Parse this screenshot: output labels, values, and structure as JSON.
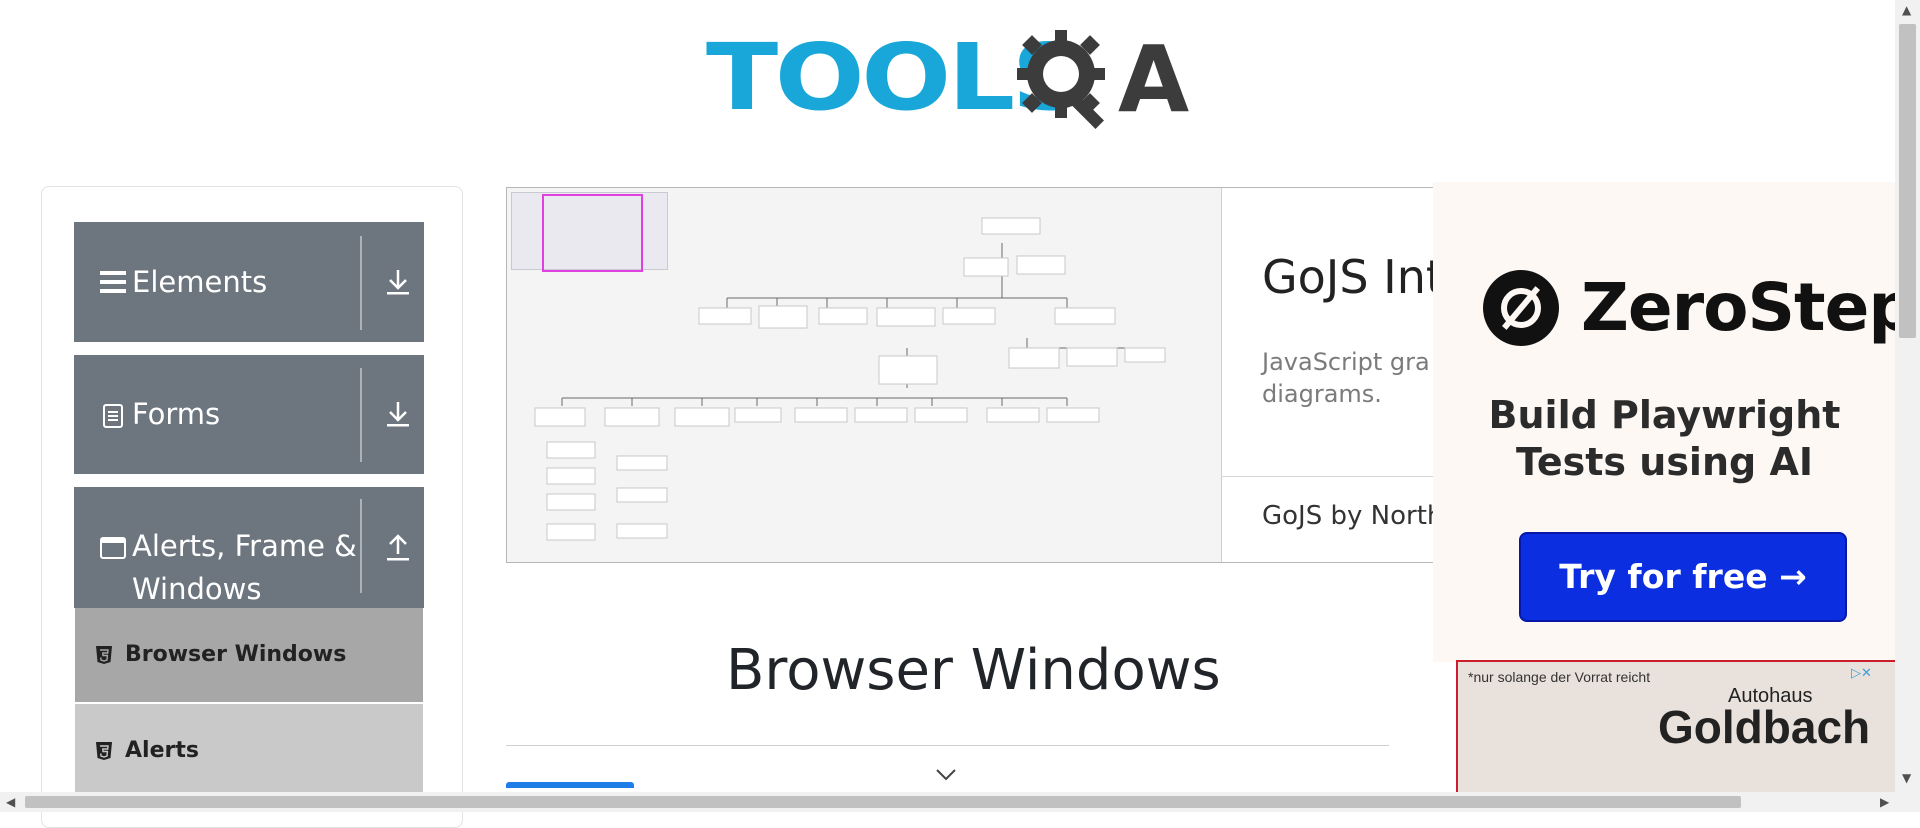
{
  "brand": {
    "logo_text_left": "TOOLS",
    "logo_text_right": "A"
  },
  "sidebar": {
    "groups": [
      {
        "label": "Elements",
        "icon": "hamburger-icon",
        "arrow": "download-arrow-icon"
      },
      {
        "label": "Forms",
        "icon": "document-icon",
        "arrow": "download-arrow-icon"
      },
      {
        "label_line1": "Alerts, Frame &",
        "label_line2": "Windows",
        "icon": "window-icon",
        "arrow": "upload-arrow-icon"
      }
    ],
    "subitems": [
      {
        "label": "Browser Windows",
        "active": true,
        "icon": "html5-icon"
      },
      {
        "label": "Alerts",
        "active": false,
        "icon": "html5-icon"
      }
    ]
  },
  "ad_gojs": {
    "title": "GoJS Int",
    "description": "JavaScript gra diagrams.",
    "footer": "GoJS by North"
  },
  "ad_zerostep": {
    "brand": "ZeroStep",
    "tagline": "Build Playwright Tests using AI",
    "cta": "Try for free →",
    "accent": "#0a2ee0"
  },
  "ad_goldbach": {
    "note": "*nur solange der Vorrat reicht",
    "line1": "Autohaus",
    "brand": "Goldbach"
  },
  "main": {
    "heading": "Browser Windows"
  },
  "colors": {
    "sidebar_group": "#6d767e",
    "active_item": "#a7a7a7",
    "inactive_item": "#c9c9c9",
    "logo_blue": "#19a7d9",
    "logo_dark": "#3c3c3c"
  }
}
